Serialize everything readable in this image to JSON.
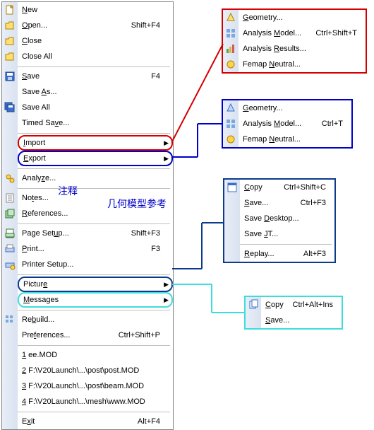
{
  "menu": {
    "new": "New",
    "open": "Open...",
    "open_sc": "Shift+F4",
    "close": "Close",
    "close_all": "Close All",
    "save": "Save",
    "save_sc": "F4",
    "save_as": "Save As...",
    "save_all": "Save All",
    "timed_save": "Timed Save...",
    "import": "Import",
    "export": "Export",
    "analyze": "Analyze...",
    "notes": "Notes...",
    "references": "References...",
    "page_setup": "Page Setup...",
    "page_setup_sc": "Shift+F3",
    "print": "Print...",
    "print_sc": "F3",
    "printer_setup": "Printer Setup...",
    "picture": "Picture",
    "messages": "Messages",
    "rebuild": "Rebuild...",
    "preferences": "Preferences...",
    "preferences_sc": "Ctrl+Shift+P",
    "r1": "1 ee.MOD",
    "r2": "2 F:\\V20Launch\\...\\post\\post.MOD",
    "r3": "3 F:\\V20Launch\\...\\post\\beam.MOD",
    "r4": "4 F:\\V20Launch\\...\\mesh\\www.MOD",
    "exit": "Exit",
    "exit_sc": "Alt+F4"
  },
  "import_menu": {
    "geometry": "Geometry...",
    "analysis_model": "Analysis Model...",
    "analysis_model_sc": "Ctrl+Shift+T",
    "analysis_results": "Analysis Results...",
    "femap_neutral": "Femap Neutral..."
  },
  "export_menu": {
    "geometry": "Geometry...",
    "analysis_model": "Analysis Model...",
    "analysis_model_sc": "Ctrl+T",
    "femap_neutral": "Femap Neutral..."
  },
  "picture_menu": {
    "copy": "Copy",
    "copy_sc": "Ctrl+Shift+C",
    "save": "Save...",
    "save_sc": "Ctrl+F3",
    "save_desktop": "Save Desktop...",
    "save_jt": "Save JT...",
    "replay": "Replay...",
    "replay_sc": "Alt+F3"
  },
  "messages_menu": {
    "copy": "Copy",
    "copy_sc": "Ctrl+Alt+Ins",
    "save": "Save..."
  },
  "ann": {
    "zhushi": "注释",
    "jihe": "几何模型参考"
  }
}
